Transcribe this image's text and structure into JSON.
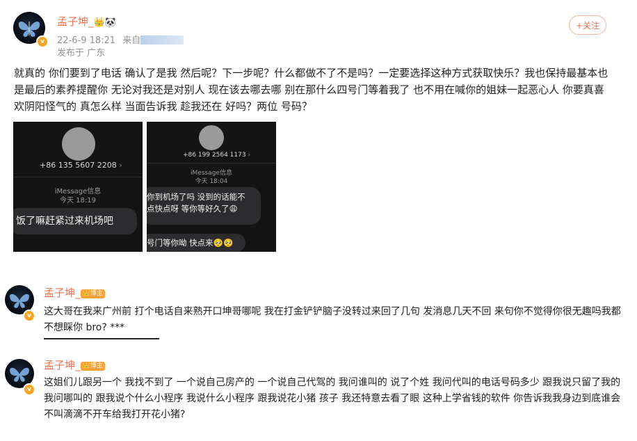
{
  "post": {
    "author": "孟子坤_",
    "author_badges": "👑🐼",
    "date": "22-6-9 18:21",
    "source_prefix": "来自",
    "location": "发布于 广东",
    "follow_label": "+关注",
    "text": "就真的 你们要到了电话 确认了是我 然后呢？下一步呢？什么都做不了不是吗？一定要选择这种方式获取快乐？我也保持最基本也是最后的素养提醒你 无论对我还是对别人 现在该去哪去哪 别在那什么四号门等着我了 也不用在喊你的姐妹一起恶心人 你要真喜欢阴阳怪气的 真怎么样 当面告诉我 趁我还在 好吗？两位 号码？"
  },
  "images": [
    {
      "phone": "+86 135 5607 2208",
      "service": "iMessage信息",
      "time": "今天 18:19",
      "messages": [
        "饭了嘛赶紧过来机场吧"
      ]
    },
    {
      "phone": "+86 199 2564 1173",
      "service": "iMessage信息",
      "time": "今天 18:04",
      "messages": [
        "你到机场了吗 没到的话能不",
        "点快点呀 等你等好久了😩",
        "号门等你呦 快点来🥺🥺"
      ]
    }
  ],
  "comments": [
    {
      "author": "孟子坤_",
      "badge": "博主",
      "text": "这大哥在我来广州前 打个电话自来熟开口坤哥哪呢 我在打金铲铲脑子没转过来回了几句 发消息几天不回 来句你不觉得你很无趣吗我都不想睬你 bro? ***"
    },
    {
      "author": "孟子坤_",
      "badge": "博主",
      "text": "这姐们儿跟另一个 我找不到了 一个说自己房产的 一个说自己代驾的 我问谁叫的 说了个姓 我问代叫的电话号码多少 跟我说只留了我的 我问哪叫的 跟我说个什么小程序 我说什么小程序 跟我说花小猪 孩子 我还特意去看了眼 这种上学省钱的软件 你告诉我我身边到底谁会不叫滴滴不开车给我打开花小猪?"
    }
  ],
  "colors": {
    "username": "#eb7350",
    "meta": "#939393",
    "badge": "#f8a23b"
  }
}
